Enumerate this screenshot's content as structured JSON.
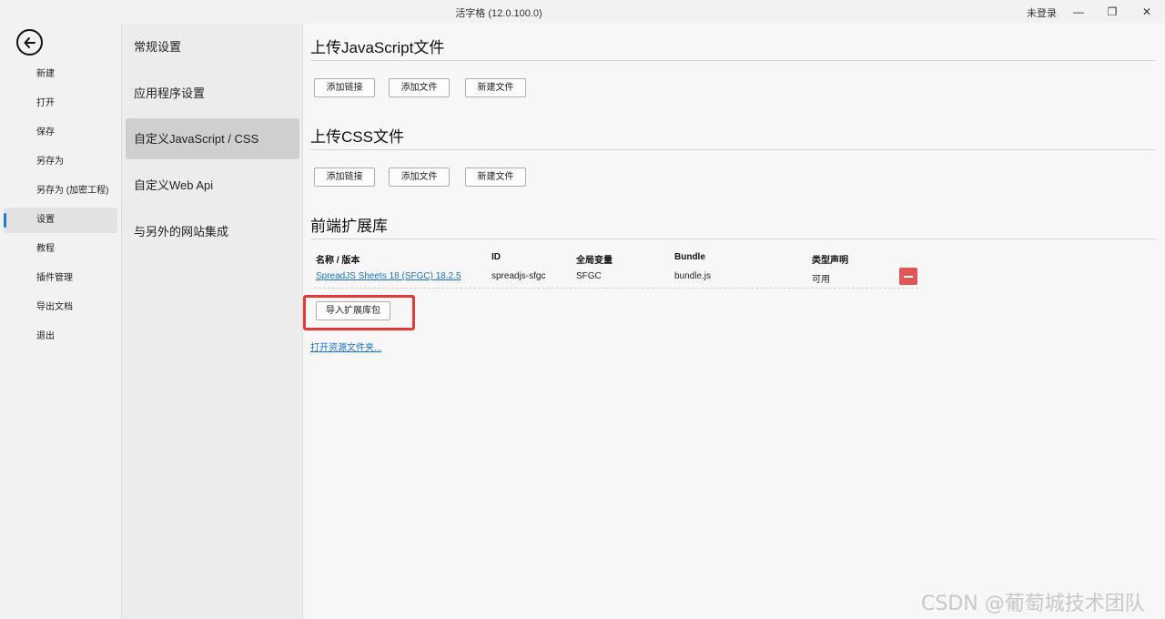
{
  "window": {
    "title": "活字格 (12.0.100.0)",
    "login_status": "未登录",
    "minimize_glyph": "—",
    "restore_glyph": "❐",
    "close_glyph": "✕"
  },
  "left_nav": {
    "items": [
      {
        "label": "新建"
      },
      {
        "label": "打开"
      },
      {
        "label": "保存"
      },
      {
        "label": "另存为"
      },
      {
        "label": "另存为 (加密工程)"
      },
      {
        "label": "设置"
      },
      {
        "label": "教程"
      },
      {
        "label": "插件管理"
      },
      {
        "label": "导出文档"
      },
      {
        "label": "退出"
      }
    ],
    "active_index": 5
  },
  "settings_nav": {
    "items": [
      {
        "label": "常规设置"
      },
      {
        "label": "应用程序设置"
      },
      {
        "label": "自定义JavaScript / CSS"
      },
      {
        "label": "自定义Web Api"
      },
      {
        "label": "与另外的网站集成"
      }
    ],
    "active_index": 2
  },
  "content": {
    "js_section": {
      "title": "上传JavaScript文件",
      "add_link": "添加链接",
      "add_file": "添加文件",
      "new_file": "新建文件"
    },
    "css_section": {
      "title": "上传CSS文件",
      "add_link": "添加链接",
      "add_file": "添加文件",
      "new_file": "新建文件"
    },
    "ext_section": {
      "title": "前端扩展库",
      "columns": [
        "名称 / 版本",
        "ID",
        "全局变量",
        "Bundle",
        "类型声明"
      ],
      "rows": [
        {
          "name": "SpreadJS Sheets 18 (SFGC)  18.2.5",
          "id": "spreadjs-sfgc",
          "global": "SFGC",
          "bundle": "bundle.js",
          "typedef": "可用"
        }
      ],
      "import_button": "导入扩展库包",
      "open_folder": "打开资源文件夹..."
    }
  },
  "watermark": "CSDN @葡萄城技术团队",
  "colors": {
    "accent": "#1a7fd4",
    "link": "#1a6fc4",
    "highlight": "#e53935",
    "remove": "#e05555"
  }
}
